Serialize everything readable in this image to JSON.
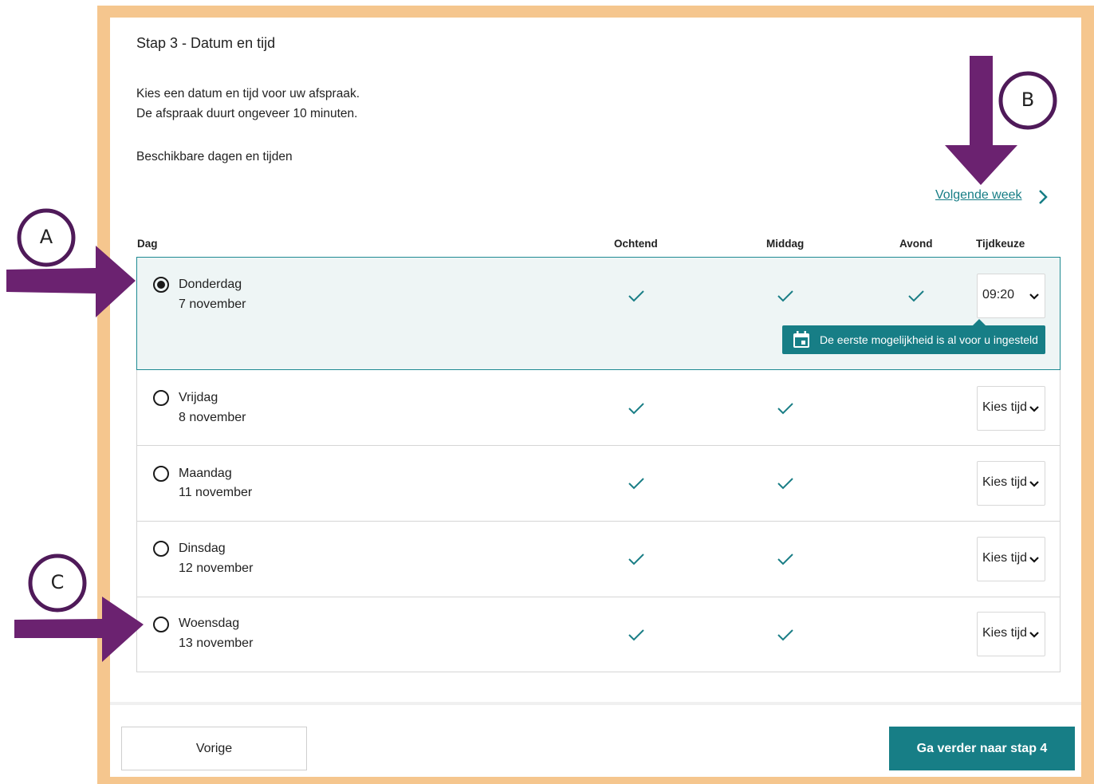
{
  "step": {
    "title": "Stap 3 - Datum en tijd"
  },
  "intro": {
    "line1": "Kies een datum en tijd voor uw afspraak.",
    "line2": "De afspraak duurt ongeveer 10 minuten."
  },
  "available_label": "Beschikbare dagen en tijden",
  "nav": {
    "next_week": "Volgende week"
  },
  "table": {
    "headers": {
      "day": "Dag",
      "morning": "Ochtend",
      "afternoon": "Middag",
      "evening": "Avond",
      "time_choice": "Tijdkeuze"
    },
    "rows": [
      {
        "day": "Donderdag",
        "date": "7 november",
        "selected": true,
        "morning": true,
        "afternoon": true,
        "evening": true,
        "time": "09:20"
      },
      {
        "day": "Vrijdag",
        "date": "8 november",
        "selected": false,
        "morning": true,
        "afternoon": true,
        "evening": false,
        "time": "Kies tijd"
      },
      {
        "day": "Maandag",
        "date": "11 november",
        "selected": false,
        "morning": true,
        "afternoon": true,
        "evening": false,
        "time": "Kies tijd"
      },
      {
        "day": "Dinsdag",
        "date": "12 november",
        "selected": false,
        "morning": true,
        "afternoon": true,
        "evening": false,
        "time": "Kies tijd"
      },
      {
        "day": "Woensdag",
        "date": "13 november",
        "selected": false,
        "morning": true,
        "afternoon": true,
        "evening": false,
        "time": "Kies tijd"
      }
    ]
  },
  "tooltip": {
    "text": "De eerste mogelijkheid is al voor u ingesteld",
    "icon": "calendar-icon"
  },
  "footer": {
    "prev_label": "Vorige",
    "next_label": "Ga verder naar stap 4"
  },
  "annotations": {
    "a": "A",
    "b": "B",
    "c": "C",
    "arrow_color": "#6b2270"
  },
  "colors": {
    "accent": "#177e86",
    "frame": "#f5c68e"
  }
}
